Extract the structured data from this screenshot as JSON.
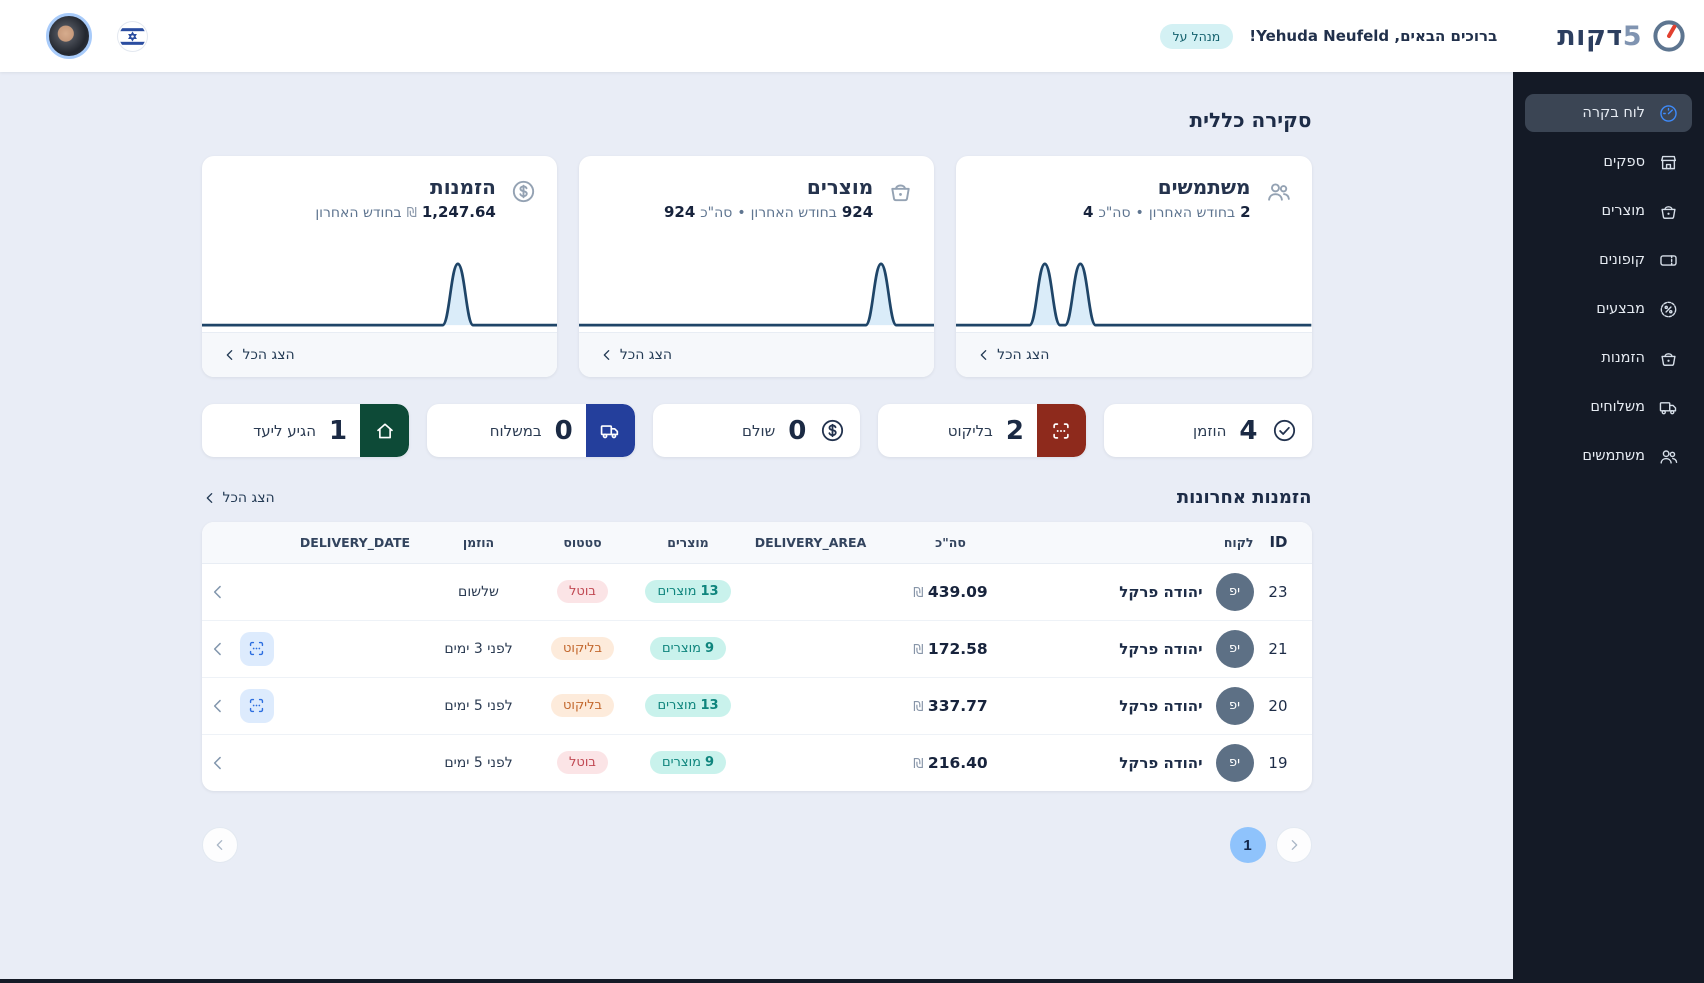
{
  "header": {
    "logo_number": "5",
    "logo_word": "דקות",
    "greeting": "ברוכים הבאים, Yehuda Neufeld!",
    "role_badge": "מנהל על"
  },
  "sidebar": {
    "items": [
      {
        "key": "dashboard",
        "label": "לוח בקרה",
        "icon": "dashboard",
        "active": true
      },
      {
        "key": "suppliers",
        "label": "ספקים",
        "icon": "store",
        "active": false
      },
      {
        "key": "products",
        "label": "מוצרים",
        "icon": "basket",
        "active": false
      },
      {
        "key": "coupons",
        "label": "קופונים",
        "icon": "ticket",
        "active": false
      },
      {
        "key": "promotions",
        "label": "מבצעים",
        "icon": "promo",
        "active": false
      },
      {
        "key": "orders",
        "label": "הזמנות",
        "icon": "basket",
        "active": false
      },
      {
        "key": "deliveries",
        "label": "משלוחים",
        "icon": "truck",
        "active": false
      },
      {
        "key": "users",
        "label": "משתמשים",
        "icon": "users",
        "active": false
      }
    ]
  },
  "overview": {
    "title": "סקירה כללית",
    "show_all_label": "הצג הכל",
    "cards": [
      {
        "key": "users",
        "title": "משתמשים",
        "icon": "users",
        "month_value": "2",
        "period_label": "בחודש האחרון",
        "separator": "•",
        "total_label": "סה\"כ",
        "total_value": "4",
        "sparkline_peaks": [
          25,
          35
        ]
      },
      {
        "key": "products",
        "title": "מוצרים",
        "icon": "basket",
        "month_value": "924",
        "period_label": "בחודש האחרון",
        "separator": "•",
        "total_label": "סה\"כ",
        "total_value": "924",
        "sparkline_peaks": [
          85
        ]
      },
      {
        "key": "orders",
        "title": "הזמנות",
        "icon": "dollar",
        "month_value": "1,247.64",
        "currency": "₪",
        "period_label": "בחודש האחרון",
        "sparkline_peaks": [
          72
        ]
      }
    ]
  },
  "status_tiles": [
    {
      "key": "ordered",
      "label": "הוזמן",
      "value": "4",
      "variant": "plain",
      "icon": "check-circle"
    },
    {
      "key": "picking",
      "label": "בליקוט",
      "value": "2",
      "variant": "red",
      "icon": "scan"
    },
    {
      "key": "paid",
      "label": "שולם",
      "value": "0",
      "variant": "plain",
      "icon": "dollar"
    },
    {
      "key": "shipping",
      "label": "במשלוח",
      "value": "0",
      "variant": "blue",
      "icon": "truck"
    },
    {
      "key": "delivered",
      "label": "הגיע ליעד",
      "value": "1",
      "variant": "green",
      "icon": "home"
    }
  ],
  "recent_orders": {
    "title": "הזמנות אחרונות",
    "show_all_label": "הצג הכל",
    "columns": [
      "ID",
      "לקוח",
      "סה\"כ",
      "DELIVERY_AREA",
      "מוצרים",
      "סטטוס",
      "הוזמן",
      "DELIVERY_DATE",
      ""
    ],
    "products_word": "מוצרים",
    "currency": "₪",
    "rows": [
      {
        "id": "23",
        "customer": "יהודה פרקל",
        "initials": "יפ",
        "total": "439.09",
        "delivery_area": "",
        "products_count": "13",
        "status": "בוטל",
        "status_variant": "canceled",
        "ordered": "שלשום",
        "delivery_date": "",
        "has_scan_action": false
      },
      {
        "id": "21",
        "customer": "יהודה פרקל",
        "initials": "יפ",
        "total": "172.58",
        "delivery_area": "",
        "products_count": "9",
        "status": "בליקוט",
        "status_variant": "picking",
        "ordered": "לפני 3 ימים",
        "delivery_date": "",
        "has_scan_action": true
      },
      {
        "id": "20",
        "customer": "יהודה פרקל",
        "initials": "יפ",
        "total": "337.77",
        "delivery_area": "",
        "products_count": "13",
        "status": "בליקוט",
        "status_variant": "picking",
        "ordered": "לפני 5 ימים",
        "delivery_date": "",
        "has_scan_action": true
      },
      {
        "id": "19",
        "customer": "יהודה פרקל",
        "initials": "יפ",
        "total": "216.40",
        "delivery_area": "",
        "products_count": "9",
        "status": "בוטל",
        "status_variant": "canceled",
        "ordered": "לפני 5 ימים",
        "delivery_date": "",
        "has_scan_action": false
      }
    ]
  },
  "pagination": {
    "current_page": "1"
  },
  "colors": {
    "page_bg": "#e9edf6",
    "sidebar_bg": "#141a26",
    "sidebar_active_bg": "#3b4554",
    "accent_blue": "#3e8bfb",
    "navy_text": "#1c2b45",
    "muted_blue": "#5f7590",
    "spark_stroke": "#1f4568",
    "spark_fill": "#daecf9",
    "tile_green": "#0d4a37",
    "tile_blue": "#243f9c",
    "tile_red": "#8e2a1c",
    "chip_teal_bg": "#c9f2ec",
    "chip_teal_text": "#0f857d",
    "chip_red_bg": "#fbe4e6",
    "chip_red_text": "#c14953",
    "chip_orange_bg": "#fdebdb",
    "chip_orange_text": "#c3682e",
    "badge_bg": "#d4f1f4",
    "badge_text": "#14616d",
    "avatar_bg": "#5d7085",
    "page_current_bg": "#8fc3fc",
    "logo_red": "#e2402f",
    "logo_gray": "#8094b1"
  }
}
